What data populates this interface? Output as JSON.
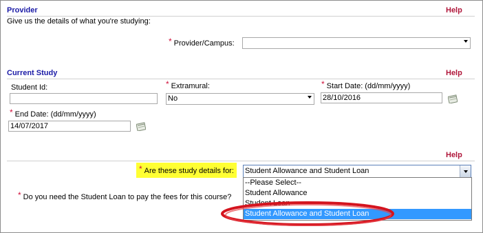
{
  "provider": {
    "title": "Provider",
    "help": "Help",
    "intro": "Give us the details of what you're studying:",
    "campus_label": "Provider/Campus:",
    "campus_value": ""
  },
  "current_study": {
    "title": "Current Study",
    "help": "Help",
    "student_id_label": "Student Id:",
    "student_id_value": "",
    "extramural_label": "Extramural:",
    "extramural_value": "No",
    "start_date_label": "Start Date: (dd/mm/yyyy)",
    "start_date_value": "28/10/2016",
    "end_date_label": "End Date: (dd/mm/yyyy)",
    "end_date_value": "14/07/2017"
  },
  "study_details": {
    "help": "Help",
    "for_label": "Are these study details for:",
    "for_value": "Student Allowance and Student Loan",
    "options": [
      "--Please Select--",
      "Student Allowance",
      "Student Loan",
      "Student Allowance and Student Loan"
    ],
    "loan_fees_label": "Do you need the Student Loan to pay the fees for this course?"
  },
  "colors": {
    "section_title": "#1a1aa6",
    "help": "#b0163a",
    "required": "#d0103a",
    "highlight": "#ffff33",
    "selected_option": "#3399ff",
    "annotation_ellipse": "#d4141e"
  },
  "icons": {
    "calendar": "calendar-icon",
    "dropdown": "chevron-down-icon"
  }
}
